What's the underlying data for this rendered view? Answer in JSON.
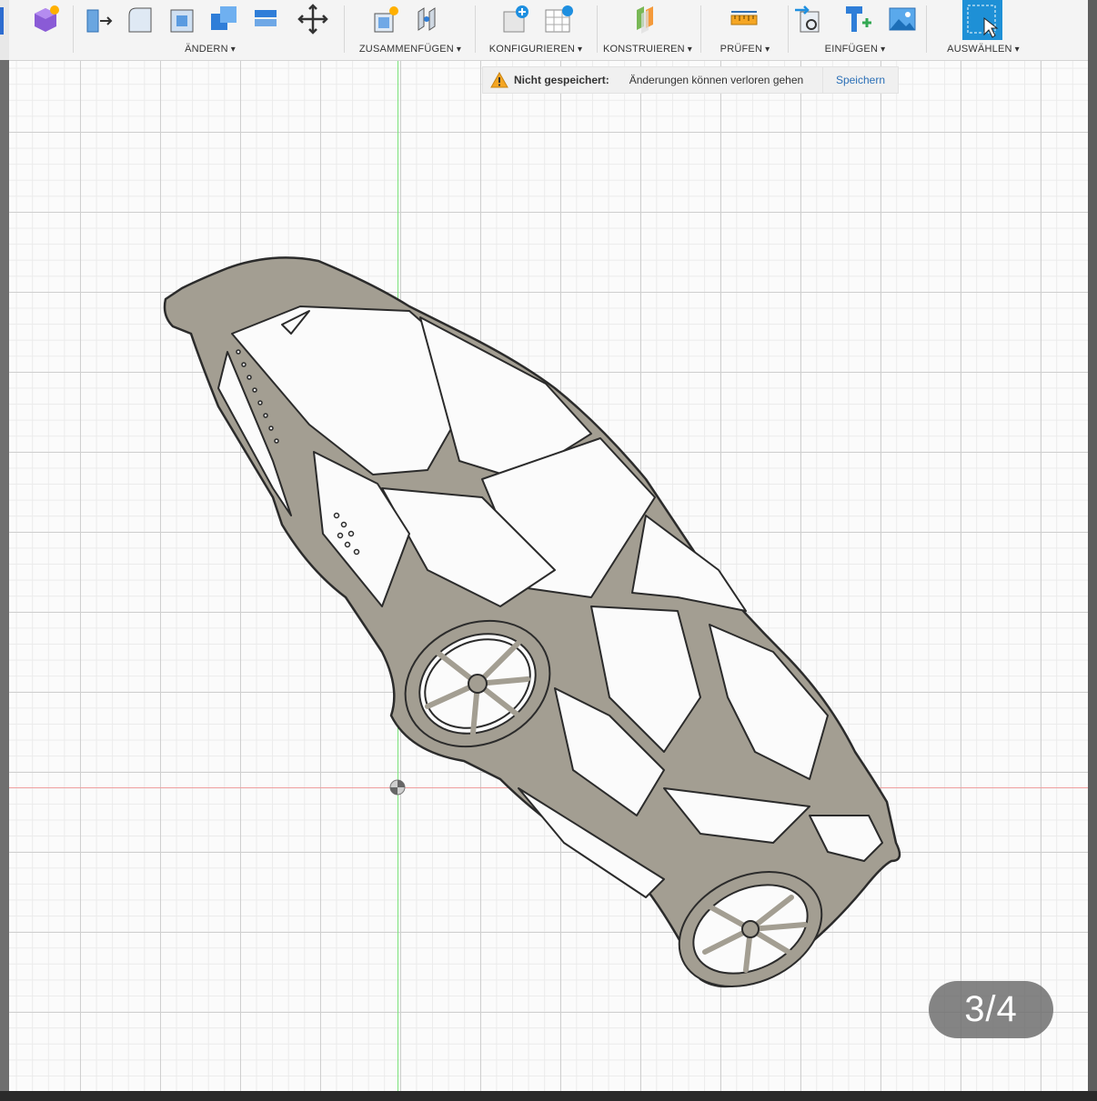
{
  "toolbar": {
    "groups": [
      {
        "label": "ÄNDERN"
      },
      {
        "label": "ZUSAMMENFÜGEN"
      },
      {
        "label": "KONFIGURIEREN"
      },
      {
        "label": "KONSTRUIEREN"
      },
      {
        "label": "PRÜFEN"
      },
      {
        "label": "EINFÜGEN"
      },
      {
        "label": "AUSWÄHLEN"
      }
    ]
  },
  "notice": {
    "title": "Nicht gespeichert:",
    "message": "Änderungen können verloren gehen",
    "action": "Speichern"
  },
  "pager": {
    "text": "3/4"
  },
  "colors": {
    "accent": "#1e90d6",
    "part_fill": "#a39e92",
    "part_outline": "#2b2b2b",
    "axis_x": "#f0a0a0",
    "axis_y": "#7be37b"
  }
}
